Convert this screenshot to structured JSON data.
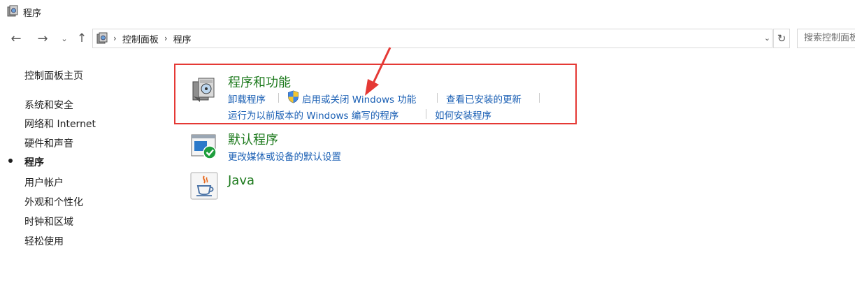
{
  "window": {
    "title": "程序"
  },
  "nav": {
    "back_icon": "back-arrow-icon",
    "forward_icon": "forward-arrow-icon",
    "recent_icon": "chevron-down-icon",
    "up_icon": "up-arrow-icon"
  },
  "address": {
    "crumbs": [
      "控制面板",
      "程序"
    ],
    "search_placeholder": "搜索控制面板"
  },
  "sidebar": {
    "items": [
      {
        "label": "控制面板主页",
        "active": false
      },
      {
        "label": "系统和安全",
        "active": false
      },
      {
        "label": "网络和 Internet",
        "active": false
      },
      {
        "label": "硬件和声音",
        "active": false
      },
      {
        "label": "程序",
        "active": true
      },
      {
        "label": "用户帐户",
        "active": false
      },
      {
        "label": "外观和个性化",
        "active": false
      },
      {
        "label": "时钟和区域",
        "active": false
      },
      {
        "label": "轻松使用",
        "active": false
      }
    ]
  },
  "categories": {
    "programs_features": {
      "title": "程序和功能",
      "links": [
        "卸载程序",
        "启用或关闭 Windows 功能",
        "查看已安装的更新",
        "运行为以前版本的 Windows 编写的程序",
        "如何安装程序"
      ]
    },
    "default_programs": {
      "title": "默认程序",
      "links": [
        "更改媒体或设备的默认设置"
      ]
    },
    "java": {
      "title": "Java"
    }
  },
  "colors": {
    "category_title": "#1d7a1d",
    "link": "#1a5fb4",
    "highlight_box": "#e53935"
  }
}
